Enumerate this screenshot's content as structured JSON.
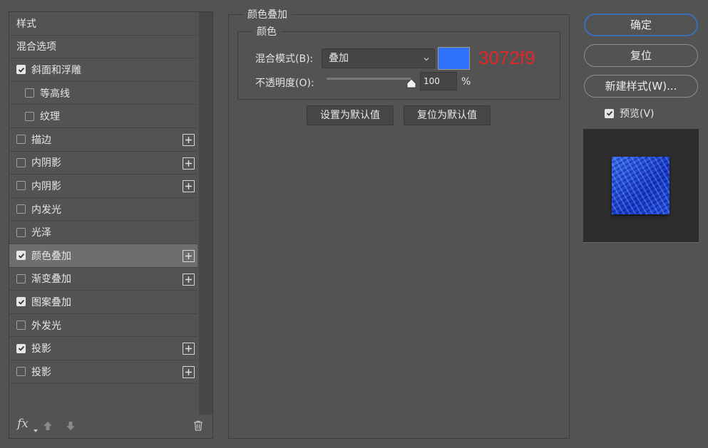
{
  "styles_panel": {
    "header": "样式",
    "blend_options": "混合选项",
    "items": [
      {
        "label": "斜面和浮雕",
        "checked": true,
        "indent": false,
        "plus": false,
        "selected": false
      },
      {
        "label": "等高线",
        "checked": false,
        "indent": true,
        "plus": false,
        "selected": false
      },
      {
        "label": "纹理",
        "checked": false,
        "indent": true,
        "plus": false,
        "selected": false
      },
      {
        "label": "描边",
        "checked": false,
        "indent": false,
        "plus": true,
        "selected": false
      },
      {
        "label": "内阴影",
        "checked": false,
        "indent": false,
        "plus": true,
        "selected": false
      },
      {
        "label": "内阴影",
        "checked": false,
        "indent": false,
        "plus": true,
        "selected": false
      },
      {
        "label": "内发光",
        "checked": false,
        "indent": false,
        "plus": false,
        "selected": false
      },
      {
        "label": "光泽",
        "checked": false,
        "indent": false,
        "plus": false,
        "selected": false
      },
      {
        "label": "颜色叠加",
        "checked": true,
        "indent": false,
        "plus": true,
        "selected": true
      },
      {
        "label": "渐变叠加",
        "checked": false,
        "indent": false,
        "plus": true,
        "selected": false
      },
      {
        "label": "图案叠加",
        "checked": true,
        "indent": false,
        "plus": false,
        "selected": false
      },
      {
        "label": "外发光",
        "checked": false,
        "indent": false,
        "plus": false,
        "selected": false
      },
      {
        "label": "投影",
        "checked": true,
        "indent": false,
        "plus": true,
        "selected": false
      },
      {
        "label": "投影",
        "checked": false,
        "indent": false,
        "plus": true,
        "selected": false
      }
    ],
    "fx_label": "fx"
  },
  "overlay": {
    "title": "颜色叠加",
    "group_title": "颜色",
    "blend_mode_label": "混合模式(B):",
    "blend_mode_value": "叠加",
    "swatch_color": "#3072f9",
    "hex_annotation": "3072f9",
    "opacity_label": "不透明度(O):",
    "opacity_value": "100",
    "opacity_unit": "%",
    "opacity_fraction": 1.0,
    "set_default": "设置为默认值",
    "reset_default": "复位为默认值"
  },
  "actions": {
    "ok": "确定",
    "reset": "复位",
    "new_style": "新建样式(W)...",
    "preview_label": "预览(V)",
    "preview_checked": true
  }
}
